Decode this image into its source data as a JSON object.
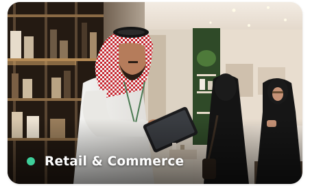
{
  "card": {
    "title": "Retail & Commerce",
    "image_icon": "retail-scene-photo",
    "accent_color": "#3ecf9a"
  }
}
